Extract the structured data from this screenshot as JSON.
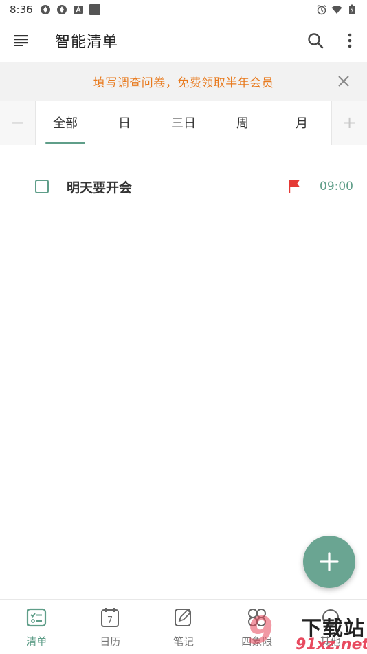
{
  "status_bar": {
    "time": "8:36",
    "left_icons": [
      "aperture-icon",
      "aperture-icon",
      "a-box-icon",
      "square-icon"
    ],
    "right_icons": [
      "alarm-icon",
      "wifi-icon",
      "battery-charging-icon"
    ]
  },
  "app_bar": {
    "title": "智能清单",
    "menu_icon": "hamburger-icon",
    "search_icon": "search-icon",
    "more_icon": "more-vertical-icon"
  },
  "banner": {
    "text": "填写调查问卷，免费领取半年会员",
    "close_icon": "close-icon",
    "text_color": "#e87a1e"
  },
  "tabs": {
    "left_symbol": "−",
    "right_symbol": "+",
    "items": [
      {
        "label": "全部",
        "active": true
      },
      {
        "label": "日",
        "active": false
      },
      {
        "label": "三日",
        "active": false
      },
      {
        "label": "周",
        "active": false
      },
      {
        "label": "月",
        "active": false
      }
    ]
  },
  "tasks": [
    {
      "title": "明天要开会",
      "time": "09:00",
      "flagged": true,
      "done": false
    }
  ],
  "fab": {
    "icon": "plus-icon"
  },
  "bottom_nav": {
    "items": [
      {
        "label": "清单",
        "icon": "checklist-icon",
        "active": true
      },
      {
        "label": "日历",
        "icon": "calendar-icon",
        "active": false,
        "badge": "7"
      },
      {
        "label": "笔记",
        "icon": "note-edit-icon",
        "active": false
      },
      {
        "label": "四象限",
        "icon": "quadrant-icon",
        "active": false
      },
      {
        "label": "其他",
        "icon": "other-icon",
        "active": false
      }
    ]
  },
  "watermark": {
    "num": "9",
    "top_text": "下载站",
    "bottom_text": "91xz.net"
  },
  "colors": {
    "accent": "#5f9e89",
    "fab": "#6aa592",
    "flag": "#e53935",
    "banner_bg": "#f2f2f2"
  }
}
